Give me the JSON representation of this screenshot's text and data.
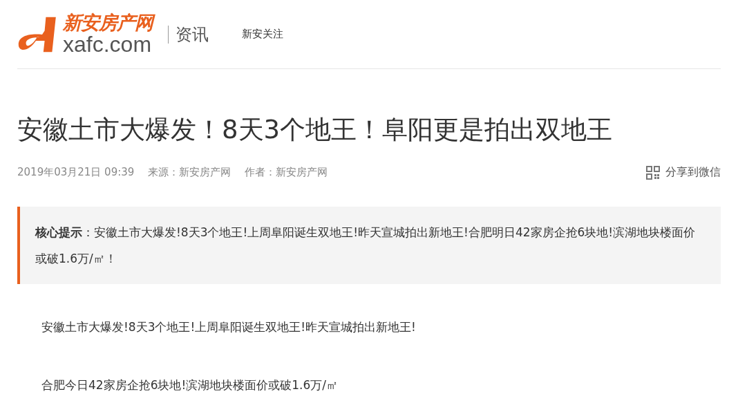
{
  "header": {
    "logo_name": "新安房产网",
    "logo_domain": "xafc.com",
    "section": "资讯",
    "nav": [
      "新安关注"
    ]
  },
  "article": {
    "title": "安徽土市大爆发！8天3个地王！阜阳更是拍出双地王",
    "meta": {
      "date": "2019年03月21日 09:39",
      "source": "来源：新安房产网",
      "author": "作者：新安房产网"
    },
    "share": "分享到微信",
    "summary": "**核心提示**：安徽土市大爆发!8天3个地王!上周阜阳诞生双地王!昨天宣城拍出新地王!合肥明日42家房企抢6块地!滨湖地块楼面价或破1.6万/㎡！",
    "paragraphs": [
      "安徽土市大爆发!8天3个地王!上周阜阳诞生双地王!昨天宣城拍出新地王!",
      "合肥今日42家房企抢6块地!滨湖地块楼面价或破1.6万/㎡"
    ]
  }
}
